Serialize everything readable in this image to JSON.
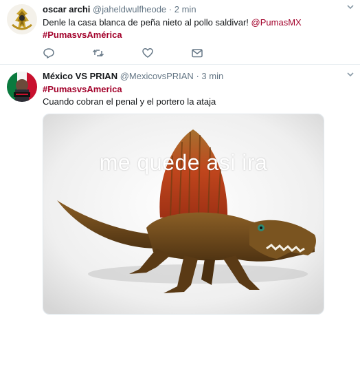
{
  "tweets": [
    {
      "name": "oscar archi",
      "handle": "@jaheldwulfheode",
      "separator": "·",
      "time": "2 min",
      "text_before_mention": "Denle la casa blanca de peña nieto al pollo saldivar! ",
      "mention": "@PumasMX",
      "hashtag": "#PumasvsAmérica",
      "avatar_icon": "gold-crest-avatar-icon",
      "actions": [
        "reply-icon",
        "retweet-icon",
        "like-icon",
        "direct-message-icon"
      ]
    },
    {
      "name": "México VS PRIAN",
      "handle": "@MexicovsPRIAN",
      "separator": "·",
      "time": "3 min",
      "hashtag": "#PumasvsAmerica",
      "text": "Cuando cobran el penal y el portero la ataja",
      "avatar_icon": "mexico-flag-avatar-icon",
      "media": {
        "caption": "me quede asi ira",
        "subject": "dinosaur-toy-image"
      }
    }
  ],
  "colors": {
    "hashtag": "#a3032c",
    "secondary_text": "#657786",
    "icon": "#8899a6",
    "divider": "#e6ecf0"
  }
}
